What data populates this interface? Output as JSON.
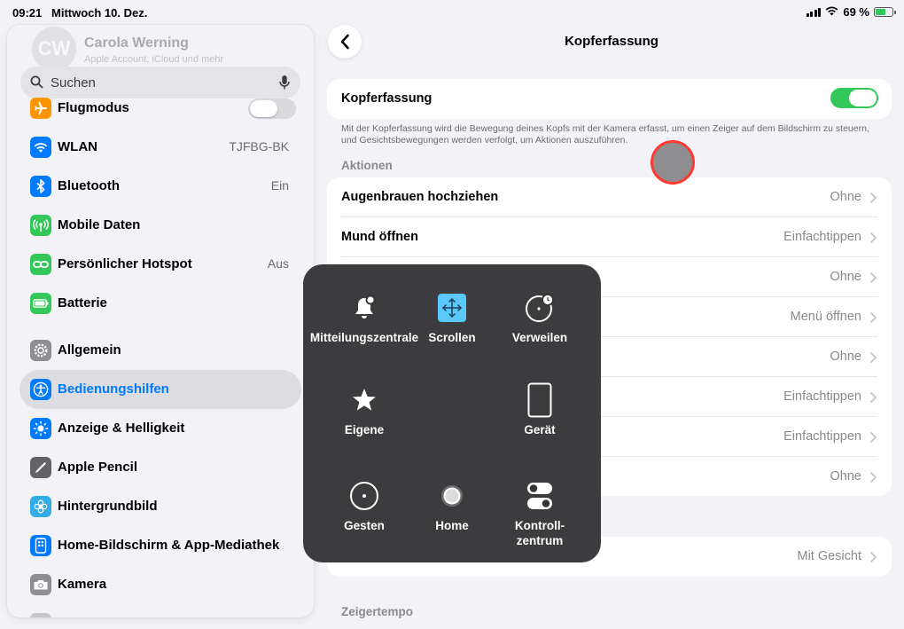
{
  "status": {
    "time": "09:21",
    "date": "Mittwoch 10. Dez.",
    "battery": "69 %",
    "battery_level": 0.69
  },
  "profile": {
    "initials": "CW",
    "name": "Carola Werning",
    "subtitle": "Apple Account, iCloud und mehr"
  },
  "search": {
    "placeholder": "Suchen"
  },
  "sidebar": {
    "items": [
      {
        "label": "Flugmodus",
        "value": "",
        "icon": "airplane-icon",
        "color": "#ff9500"
      },
      {
        "label": "WLAN",
        "value": "TJFBG-BK",
        "icon": "wifi-icon",
        "color": "#007aff"
      },
      {
        "label": "Bluetooth",
        "value": "Ein",
        "icon": "bluetooth-icon",
        "color": "#007aff"
      },
      {
        "label": "Mobile Daten",
        "value": "",
        "icon": "antenna-icon",
        "color": "#34c759"
      },
      {
        "label": "Persönlicher Hotspot",
        "value": "Aus",
        "icon": "hotspot-icon",
        "color": "#34c759"
      },
      {
        "label": "Batterie",
        "value": "",
        "icon": "battery-icon",
        "color": "#34c759"
      },
      {
        "label": "Allgemein",
        "value": "",
        "icon": "gear-icon",
        "color": "#8e8e93"
      },
      {
        "label": "Bedienungshilfen",
        "value": "",
        "icon": "accessibility-icon",
        "color": "#007aff"
      },
      {
        "label": "Anzeige & Helligkeit",
        "value": "",
        "icon": "sun-icon",
        "color": "#007aff"
      },
      {
        "label": "Apple Pencil",
        "value": "",
        "icon": "pencil-icon",
        "color": "#636366"
      },
      {
        "label": "Hintergrundbild",
        "value": "",
        "icon": "flower-icon",
        "color": "#32ade6"
      },
      {
        "label": "Home-Bildschirm & App-Mediathek",
        "value": "",
        "icon": "home-screen-icon",
        "color": "#007aff"
      },
      {
        "label": "Kamera",
        "value": "",
        "icon": "camera-icon",
        "color": "#8e8e93"
      }
    ]
  },
  "detail": {
    "title": "Kopferfassung",
    "toggle_label": "Kopferfassung",
    "toggle_on": true,
    "footnote": "Mit der Kopferfassung wird die Bewegung deines Kopfs mit der Kamera erfasst, um einen Zeiger auf dem Bildschirm zu steuern, und Gesichtsbewegungen werden verfolgt, um Aktionen auszuführen.",
    "actions_header": "Aktionen",
    "actions": [
      {
        "label": "Augenbrauen hochziehen",
        "value": "Ohne"
      },
      {
        "label": "Mund öffnen",
        "value": "Einfachtippen"
      },
      {
        "label": "",
        "value": "Ohne"
      },
      {
        "label": "",
        "value": "Menü öffnen"
      },
      {
        "label": "",
        "value": "Ohne"
      },
      {
        "label": "",
        "value": "Einfachtippen"
      },
      {
        "label": "",
        "value": "Einfachtippen"
      },
      {
        "label": "",
        "value": "Ohne"
      }
    ],
    "mode_value": "Mit Gesicht",
    "speed_header": "Zeigertempo"
  },
  "menu": {
    "items": [
      {
        "label": "Mitteilungszentrale",
        "icon": "bell-icon"
      },
      {
        "label": "Scrollen",
        "icon": "scroll-arrows-icon"
      },
      {
        "label": "Verweilen",
        "icon": "dwell-timer-icon"
      },
      {
        "label": "Eigene",
        "icon": "star-icon"
      },
      {
        "label": "Gerät",
        "icon": "ipad-icon"
      },
      {
        "label": "Gesten",
        "icon": "gesture-circle-icon"
      },
      {
        "label": "Home",
        "icon": "home-button-icon"
      },
      {
        "label": "Kontroll-\nzentrum",
        "label_line1": "Kontroll-",
        "label_line2": "zentrum",
        "icon": "switches-icon"
      }
    ]
  }
}
